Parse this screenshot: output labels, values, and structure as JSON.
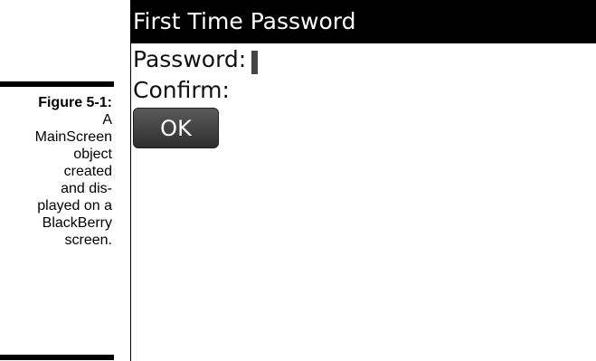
{
  "caption": {
    "label": "Figure 5-1:",
    "lines": [
      "A",
      "MainScreen",
      "object",
      "created",
      "and dis-",
      "played on a",
      "BlackBerry",
      "screen."
    ]
  },
  "screen": {
    "title": "First Time Password",
    "fields": [
      {
        "label": "Password:",
        "value": ""
      },
      {
        "label": "Confirm:",
        "value": ""
      }
    ],
    "ok_label": "OK"
  },
  "colors": {
    "titlebar_bg": "#000000",
    "titlebar_text": "#ffffff",
    "button_bg": "#3c3c3c",
    "cursor": "#444444"
  }
}
